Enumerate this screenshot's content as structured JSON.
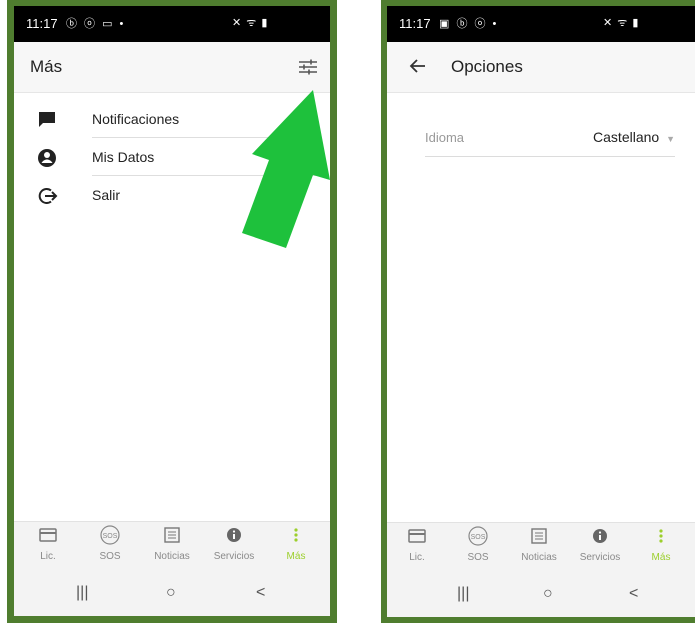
{
  "left_screen": {
    "status": {
      "time": "11:17",
      "left_icons": "ⓑ ⓞ ▭ •",
      "right_icons": "✕ ᯤ ▮"
    },
    "appbar": {
      "title": "Más"
    },
    "menu": [
      {
        "label": "Notificaciones",
        "icon": "chat-icon"
      },
      {
        "label": "Mis Datos",
        "icon": "account-icon"
      },
      {
        "label": "Salir",
        "icon": "logout-icon"
      }
    ],
    "nav": [
      {
        "label": "Lic.",
        "icon": "card-icon"
      },
      {
        "label": "SOS",
        "icon": "sos-icon"
      },
      {
        "label": "Noticias",
        "icon": "newspaper-icon"
      },
      {
        "label": "Servicios",
        "icon": "info-icon"
      },
      {
        "label": "Más",
        "icon": "more-icon",
        "active": true
      }
    ],
    "system_nav": [
      "|||",
      "○",
      "<"
    ]
  },
  "right_screen": {
    "status": {
      "time": "11:17",
      "left_icons": "▣ ⓑ ⓞ •",
      "right_icons": "✕ ᯤ ▮"
    },
    "appbar": {
      "title": "Opciones"
    },
    "option": {
      "label": "Idioma",
      "value": "Castellano"
    },
    "nav": [
      {
        "label": "Lic.",
        "icon": "card-icon"
      },
      {
        "label": "SOS",
        "icon": "sos-icon"
      },
      {
        "label": "Noticias",
        "icon": "newspaper-icon"
      },
      {
        "label": "Servicios",
        "icon": "info-icon"
      },
      {
        "label": "Más",
        "icon": "more-icon",
        "active": true
      }
    ],
    "system_nav": [
      "|||",
      "○",
      "<"
    ]
  },
  "colors": {
    "frame": "#4f7d2f",
    "accent": "#9ccf2c",
    "arrow": "#1ec13c"
  }
}
